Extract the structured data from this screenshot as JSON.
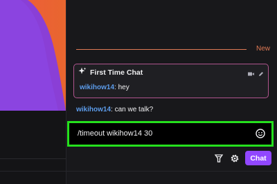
{
  "new_marker": {
    "label": "New"
  },
  "first_time_chat": {
    "title": "First Time Chat",
    "message": {
      "username": "wikihow14",
      "separator": ":",
      "text": " hey"
    }
  },
  "messages": [
    {
      "username": "wikihow14",
      "separator": ":",
      "text": " can we talk?"
    }
  ],
  "chat_input": {
    "value": "/timeout wikihow14 30"
  },
  "toolbar": {
    "chat_button_label": "Chat"
  },
  "colors": {
    "accent_purple": "#9147ff",
    "new_marker": "#e07a55",
    "first_time_border": "#b0558e",
    "username": "#5c9ceb",
    "highlight": "#25e01d"
  },
  "icons": [
    "sparkle-icon",
    "video-icon",
    "pencil-icon",
    "emoji-icon",
    "cheer-icon",
    "gear-icon"
  ]
}
